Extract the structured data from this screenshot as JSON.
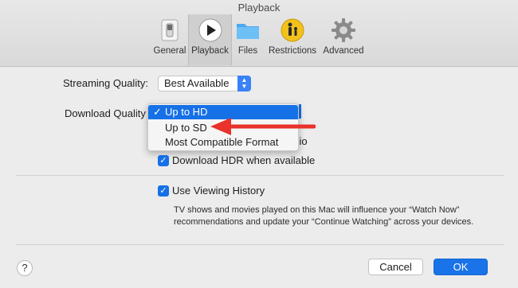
{
  "window": {
    "title": "Playback"
  },
  "toolbar": {
    "items": [
      {
        "label": "General",
        "icon": "switch-icon"
      },
      {
        "label": "Playback",
        "icon": "play-circle-icon"
      },
      {
        "label": "Files",
        "icon": "folder-icon"
      },
      {
        "label": "Restrictions",
        "icon": "parental-icon"
      },
      {
        "label": "Advanced",
        "icon": "gear-icon"
      }
    ],
    "selected": "Playback"
  },
  "streaming": {
    "label": "Streaming Quality:",
    "value": "Best Available"
  },
  "download": {
    "label": "Download Quality",
    "options": [
      "Up to HD",
      "Up to SD",
      "Most Compatible Format"
    ],
    "selected": "Up to HD",
    "checkmark": "✓"
  },
  "hidden_label_fragment": "udio",
  "hdr": {
    "label": "Download HDR when available",
    "checked": true
  },
  "history": {
    "label": "Use Viewing History",
    "checked": true,
    "description": "TV shows and movies played on this Mac will influence your “Watch Now” recommendations and update your “Continue Watching” across your devices."
  },
  "buttons": {
    "help": "?",
    "cancel": "Cancel",
    "ok": "OK"
  },
  "colors": {
    "accent": "#1670e6",
    "annotation_arrow": "#e8322a"
  }
}
